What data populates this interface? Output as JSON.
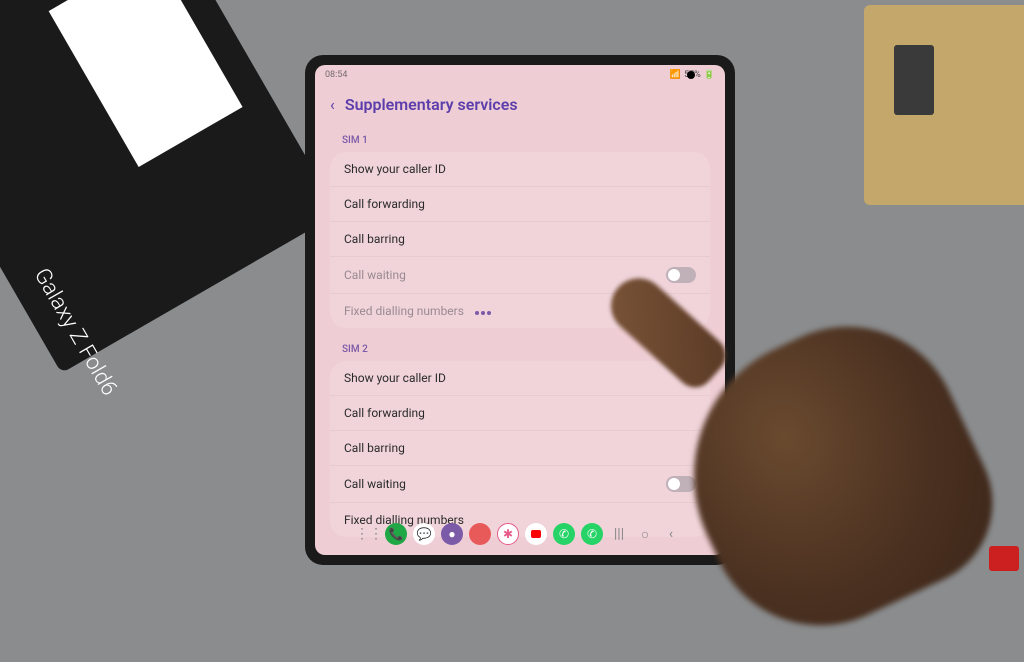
{
  "product": {
    "name": "Galaxy Z Fold6"
  },
  "statusBar": {
    "time": "08:54",
    "battery": "57%"
  },
  "header": {
    "title": "Supplementary services"
  },
  "sim1": {
    "label": "SIM 1",
    "items": {
      "callerID": "Show your caller ID",
      "forwarding": "Call forwarding",
      "barring": "Call barring",
      "waiting": "Call waiting",
      "fixedDialling": "Fixed dialling numbers"
    }
  },
  "sim2": {
    "label": "SIM 2",
    "items": {
      "callerID": "Show your caller ID",
      "forwarding": "Call forwarding",
      "barring": "Call barring",
      "waiting": "Call waiting",
      "fixedDialling": "Fixed dialling numbers"
    }
  }
}
